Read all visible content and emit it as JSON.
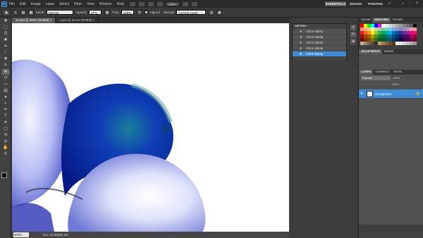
{
  "app": {
    "logo": "Ps"
  },
  "menubar": {
    "items": [
      "File",
      "Edit",
      "Image",
      "Layer",
      "Select",
      "Filter",
      "View",
      "Window",
      "Help"
    ],
    "zoom": "200%",
    "workspaces": [
      "ESSENTIALS",
      "DESIGN",
      "PAINTING"
    ],
    "more": "»"
  },
  "options": {
    "mode_label": "Mode:",
    "mode_value": "Normal",
    "opacity_label": "Opacity:",
    "opacity_value": "27%",
    "flow_label": "Flow:",
    "flow_value": "100%",
    "aligned_label": "Aligned",
    "sample_label": "Sample:",
    "sample_value": "Current Layer"
  },
  "tabs": [
    {
      "label": "10.psd @ 200% (RGB/8) ×",
      "active": true
    },
    {
      "label": "3.psd @ 33.3% (RGB/8) ×",
      "active": false
    }
  ],
  "history": {
    "title": "HISTORY",
    "items": [
      "Clone Stamp",
      "Clone Stamp",
      "Clone Stamp",
      "Clone Stamp",
      "Clone Stamp"
    ],
    "active_index": 4
  },
  "color_panel": {
    "tabs": [
      "COLOR",
      "SWATCHES",
      "STYLES"
    ],
    "active_tab": "SWATCHES",
    "swatches": [
      "#ff0000",
      "#ffff00",
      "#00ff00",
      "#00ffff",
      "#0000ff",
      "#ff00ff",
      "#ffffff",
      "#ebebeb",
      "#d6d6d6",
      "#c2c2c2",
      "#adadad",
      "#999999",
      "#858585",
      "#707070",
      "#5c5c5c",
      "#000000",
      "#f7977a",
      "#f9ad81",
      "#fdc68a",
      "#fff79a",
      "#c4df9b",
      "#a2d39c",
      "#82ca9d",
      "#7bcdc8",
      "#6ecff6",
      "#7ea7d8",
      "#8493ca",
      "#8882be",
      "#a187be",
      "#bc8dbf",
      "#f49ac2",
      "#f6989d",
      "#ed1c24",
      "#f26522",
      "#f7941d",
      "#fff200",
      "#8dc73f",
      "#39b54a",
      "#00a651",
      "#00a99d",
      "#00aeef",
      "#0072bc",
      "#0054a6",
      "#2e3192",
      "#662d91",
      "#92278f",
      "#ec008c",
      "#ed145b",
      "#9e0b0f",
      "#a0410d",
      "#a36209",
      "#aba000",
      "#598527",
      "#1a7b30",
      "#007236",
      "#00746b",
      "#0076a3",
      "#004b80",
      "#003471",
      "#1b1464",
      "#440e62",
      "#630460",
      "#9e005d",
      "#9e0039",
      "#790000",
      "#7b2e00",
      "#7d4900",
      "#827b00",
      "#406618",
      "#005e20",
      "#005826",
      "#005952",
      "#005b7f",
      "#003663",
      "#002157",
      "#0d004c",
      "#32004b",
      "#4b0049",
      "#7b0046",
      "#7a0026",
      "#c7b299",
      "#998675",
      "#736357",
      "#534741",
      "#37302d",
      "#c69c6d",
      "#a67c52",
      "#8c6239",
      "#754c24",
      "#603913",
      "#ffffff",
      "#ebebeb",
      "#d6d6d6",
      "#c2c2c2",
      "#adadad",
      "#999999"
    ]
  },
  "layers_panel": {
    "tabs": [
      "LAYERS",
      "CHANNELS",
      "PATHS"
    ],
    "adjust_tabs": [
      "ADJUSTMENTS",
      "MASKS"
    ],
    "blend_mode": "Normal",
    "opacity": "100%",
    "fill": "100%",
    "layer_name": "Background"
  },
  "status": {
    "zoom": "200%",
    "doc": "Doc: 22.8M/26.1M"
  },
  "colors": {
    "selection": "#3f8bd5",
    "canvas": "#ffffff",
    "chrome": "#3c3c3c"
  }
}
